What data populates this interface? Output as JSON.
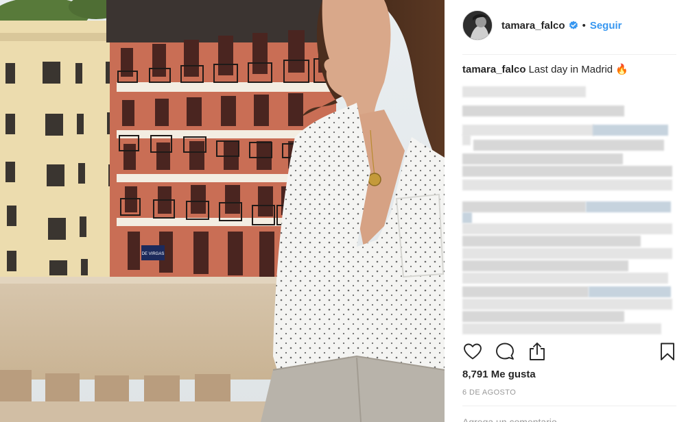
{
  "post": {
    "username": "tamara_falco",
    "separator": "•",
    "follow_label": "Seguir",
    "caption_user": "tamara_falco",
    "caption_text": "Last day in Madrid 🔥",
    "likes": "8,791 Me gusta",
    "date": "6 DE AGOSTO",
    "comment_placeholder": "Agrega un comentario..."
  },
  "photo": {
    "street_sign": "DE VIRGAS"
  },
  "icons": {
    "verified": "verified-badge-icon",
    "like": "heart-icon",
    "comment": "comment-bubble-icon",
    "share": "share-upload-icon",
    "save": "bookmark-icon"
  },
  "colors": {
    "link_blue": "#3897f0",
    "text": "#262626",
    "muted": "#999999",
    "divider": "#efefef"
  }
}
